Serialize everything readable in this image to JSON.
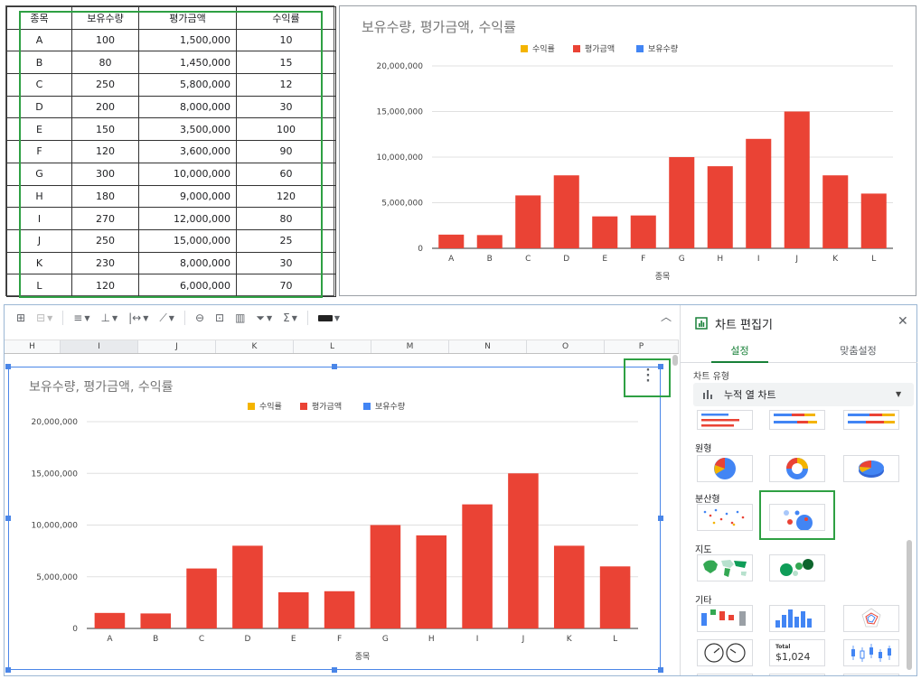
{
  "table": {
    "headers": [
      "종목",
      "보유수량",
      "평가금액",
      "수익률"
    ],
    "rows": [
      [
        "A",
        "100",
        "1,500,000",
        "10"
      ],
      [
        "B",
        "80",
        "1,450,000",
        "15"
      ],
      [
        "C",
        "250",
        "5,800,000",
        "12"
      ],
      [
        "D",
        "200",
        "8,000,000",
        "30"
      ],
      [
        "E",
        "150",
        "3,500,000",
        "100"
      ],
      [
        "F",
        "120",
        "3,600,000",
        "90"
      ],
      [
        "G",
        "300",
        "10,000,000",
        "60"
      ],
      [
        "H",
        "180",
        "9,000,000",
        "120"
      ],
      [
        "I",
        "270",
        "12,000,000",
        "80"
      ],
      [
        "J",
        "250",
        "15,000,000",
        "25"
      ],
      [
        "K",
        "230",
        "8,000,000",
        "30"
      ],
      [
        "L",
        "120",
        "6,000,000",
        "70"
      ]
    ]
  },
  "chart_data": [
    {
      "type": "bar",
      "title": "보유수량, 평가금액, 수익률",
      "xlabel": "종목",
      "ylabel": "",
      "categories": [
        "A",
        "B",
        "C",
        "D",
        "E",
        "F",
        "G",
        "H",
        "I",
        "J",
        "K",
        "L"
      ],
      "series": [
        {
          "name": "수익률",
          "color": "#f4b400",
          "values": [
            10,
            15,
            12,
            30,
            100,
            90,
            60,
            120,
            80,
            25,
            30,
            70
          ]
        },
        {
          "name": "평가금액",
          "color": "#ea4335",
          "values": [
            1500000,
            1450000,
            5800000,
            8000000,
            3500000,
            3600000,
            10000000,
            9000000,
            12000000,
            15000000,
            8000000,
            6000000
          ]
        },
        {
          "name": "보유수량",
          "color": "#4285f4",
          "values": [
            100,
            80,
            250,
            200,
            150,
            120,
            300,
            180,
            270,
            250,
            230,
            120
          ]
        }
      ],
      "ylim": [
        0,
        20000000
      ],
      "yticks": [
        "0",
        "5,000,000",
        "10,000,000",
        "15,000,000",
        "20,000,000"
      ],
      "grid": true,
      "legend": "top"
    },
    {
      "type": "bar",
      "title": "보유수량, 평가금액, 수익률",
      "xlabel": "종목",
      "ylabel": "",
      "categories": [
        "A",
        "B",
        "C",
        "D",
        "E",
        "F",
        "G",
        "H",
        "I",
        "J",
        "K",
        "L"
      ],
      "series": [
        {
          "name": "수익률",
          "color": "#f4b400",
          "values": [
            10,
            15,
            12,
            30,
            100,
            90,
            60,
            120,
            80,
            25,
            30,
            70
          ]
        },
        {
          "name": "평가금액",
          "color": "#ea4335",
          "values": [
            1500000,
            1450000,
            5800000,
            8000000,
            3500000,
            3600000,
            10000000,
            9000000,
            12000000,
            15000000,
            8000000,
            6000000
          ]
        },
        {
          "name": "보유수량",
          "color": "#4285f4",
          "values": [
            100,
            80,
            250,
            200,
            150,
            120,
            300,
            180,
            270,
            250,
            230,
            120
          ]
        }
      ],
      "ylim": [
        0,
        20000000
      ],
      "yticks": [
        "0",
        "5,000,000",
        "10,000,000",
        "15,000,000",
        "20,000,000"
      ],
      "grid": true,
      "legend": "top"
    }
  ],
  "sheet": {
    "columns": [
      "H",
      "I",
      "J",
      "K",
      "L",
      "M",
      "N",
      "O",
      "P"
    ],
    "selected_column": "I"
  },
  "editor": {
    "title": "차트 편집기",
    "close_icon": "close-icon",
    "tabs": [
      "설정",
      "맞춤설정"
    ],
    "active_tab": "설정",
    "chart_type_label": "차트 유형",
    "chart_type_value": "누적 열 차트",
    "categories": [
      "원형",
      "분산형",
      "지도",
      "기타"
    ],
    "total_label": "Total",
    "total_value": "$1,024"
  },
  "colors": {
    "highlight": "#2ea043",
    "selection": "#4a86e8",
    "accent_green": "#188038"
  }
}
